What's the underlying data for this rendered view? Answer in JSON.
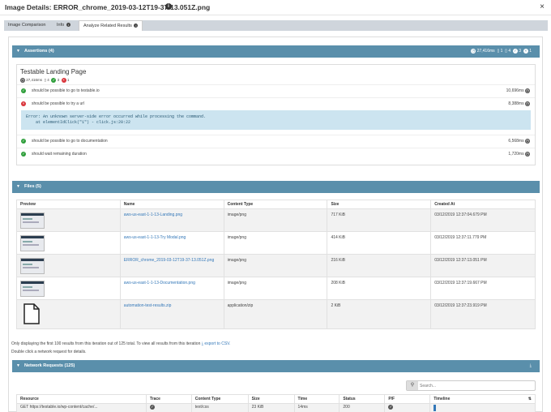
{
  "title": "Image Details: ERROR_chrome_2019-03-12T19-37-13.051Z.png",
  "tabs": [
    {
      "label": "Image Comparison"
    },
    {
      "label": "Info"
    },
    {
      "label": "Analyze Related Results"
    }
  ],
  "assertions": {
    "header": "Assertions (4)",
    "summary": {
      "duration": "27,416ms",
      "files": "1",
      "tests": "4",
      "passed": "3",
      "failed": "1"
    },
    "page_title": "Testable Landing Page",
    "meta": {
      "duration": "27,416ms",
      "tests": "4",
      "passed": "3",
      "failed": "1"
    },
    "items": [
      {
        "text": "should be possible to go to testable.io",
        "duration": "10,696ms",
        "status": "pass"
      },
      {
        "text": "should be possible to try a url",
        "duration": "8,388ms",
        "status": "fail"
      },
      {
        "text": "should be possible to go to documentation",
        "duration": "6,568ms",
        "status": "pass"
      },
      {
        "text": "should wait remaining duration",
        "duration": "1,720ms",
        "status": "pass"
      }
    ],
    "error_line1": "Error: An unknown server-side error occurred while processing the command.",
    "error_line2": "    at elementIdClick(\"1\") - click.js:20:22"
  },
  "files": {
    "header": "Files (5)",
    "columns": [
      "Preview",
      "Name",
      "Content Type",
      "Size",
      "Created At"
    ],
    "rows": [
      {
        "name": "aws-us-east-1-1-13-Landing.png",
        "type": "image/png",
        "size": "717 KiB",
        "created": "03/12/2019 12:37:04.679 PM"
      },
      {
        "name": "aws-us-east-1-1-13-Try Modal.png",
        "type": "image/png",
        "size": "414 KiB",
        "created": "03/12/2019 12:37:11.779 PM"
      },
      {
        "name": "ERROR_chrome_2019-03-12T19-37-13.051Z.png",
        "type": "image/png",
        "size": "216 KiB",
        "created": "03/12/2019 12:37:13.051 PM"
      },
      {
        "name": "aws-us-east-1-1-13-Documentation.png",
        "type": "image/png",
        "size": "208 KiB",
        "created": "03/12/2019 12:37:19.667 PM"
      },
      {
        "name": "automation-test-results.zip",
        "type": "application/zip",
        "size": "2 KiB",
        "created": "03/12/2019 12:37:23.919 PM"
      }
    ],
    "note1": "Only displaying the first 100 results from this iteration out of 125 total. To view all results from this iteration",
    "export_link": "export to CSV.",
    "note2": "Double click a network request for details."
  },
  "network": {
    "header": "Network Requests (125)",
    "search_placeholder": "Search...",
    "columns": [
      "Resource",
      "Trace",
      "Content Type",
      "Size",
      "Time",
      "Status",
      "P/F",
      "Timeline"
    ],
    "rows": [
      {
        "resource": "GET https://testable.io/wp-content/cache/...",
        "type": "text/css",
        "size": "23 KiB",
        "time": "14ms",
        "status": "200"
      }
    ]
  }
}
